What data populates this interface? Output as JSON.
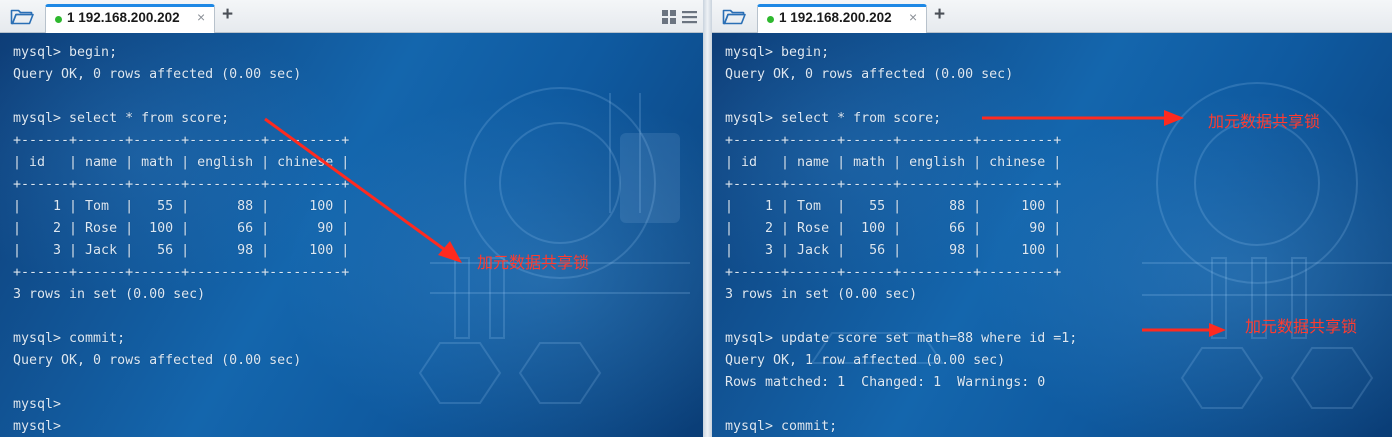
{
  "colors": {
    "accent": "#1e88e5",
    "status_dot": "#2eb82e",
    "terminal_text": "#dce8f4",
    "annotation": "#ff3b2f"
  },
  "icons": {
    "open_folder": "folder-open-icon",
    "close": "close-icon",
    "new_tab": "plus-icon",
    "layout": "grid-list-icon"
  },
  "left_pane": {
    "tab": {
      "label": "1 192.168.200.202",
      "close": "×"
    },
    "new_tab": "+",
    "terminal_lines": [
      "mysql> begin;",
      "Query OK, 0 rows affected (0.00 sec)",
      "",
      "mysql> select * from score;",
      "+------+------+------+---------+---------+",
      "| id   | name | math | english | chinese |",
      "+------+------+------+---------+---------+",
      "|    1 | Tom  |   55 |      88 |     100 |",
      "|    2 | Rose |  100 |      66 |      90 |",
      "|    3 | Jack |   56 |      98 |     100 |",
      "+------+------+------+---------+---------+",
      "3 rows in set (0.00 sec)",
      "",
      "mysql> commit;",
      "Query OK, 0 rows affected (0.00 sec)",
      "",
      "mysql>",
      "mysql>"
    ],
    "annotation": "加元数据共享锁"
  },
  "right_pane": {
    "tab": {
      "label": "1 192.168.200.202",
      "close": "×"
    },
    "new_tab": "+",
    "terminal_lines": [
      "mysql> begin;",
      "Query OK, 0 rows affected (0.00 sec)",
      "",
      "mysql> select * from score;",
      "+------+------+------+---------+---------+",
      "| id   | name | math | english | chinese |",
      "+------+------+------+---------+---------+",
      "|    1 | Tom  |   55 |      88 |     100 |",
      "|    2 | Rose |  100 |      66 |      90 |",
      "|    3 | Jack |   56 |      98 |     100 |",
      "+------+------+------+---------+---------+",
      "3 rows in set (0.00 sec)",
      "",
      "mysql> update score set math=88 where id =1;",
      "Query OK, 1 row affected (0.00 sec)",
      "Rows matched: 1  Changed: 1  Warnings: 0",
      "",
      "mysql> commit;"
    ],
    "annotation_top": "加元数据共享锁",
    "annotation_bottom": "加元数据共享锁"
  }
}
